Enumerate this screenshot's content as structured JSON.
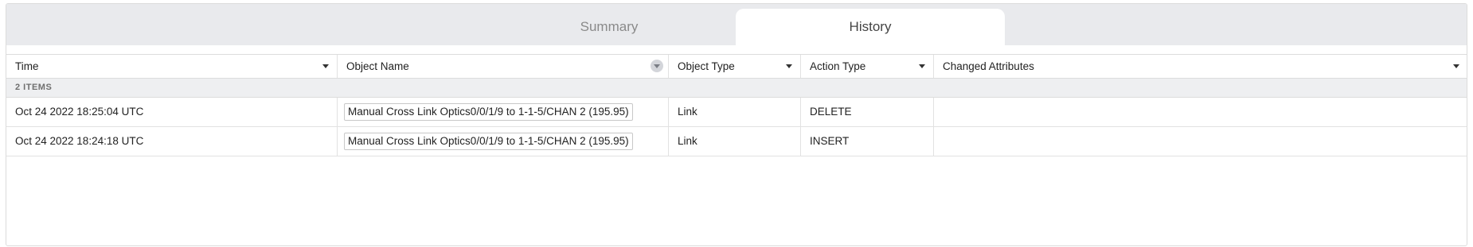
{
  "tabs": [
    {
      "label": "Summary",
      "active": false
    },
    {
      "label": "History",
      "active": true
    }
  ],
  "table": {
    "columns": [
      "Time",
      "Object Name",
      "Object Type",
      "Action Type",
      "Changed Attributes"
    ],
    "group_label": "2 ITEMS",
    "rows": [
      {
        "time": "Oct 24 2022 18:25:04 UTC",
        "object_name": "Manual Cross Link Optics0/0/1/9 to 1-1-5/CHAN 2 (195.95)",
        "object_type": "Link",
        "action_type": "DELETE",
        "changed_attributes": ""
      },
      {
        "time": "Oct 24 2022 18:24:18 UTC",
        "object_name": "Manual Cross Link Optics0/0/1/9 to 1-1-5/CHAN 2 (195.95)",
        "object_type": "Link",
        "action_type": "INSERT",
        "changed_attributes": ""
      }
    ]
  },
  "icons": {
    "column_menu": "caret-down-icon",
    "sort_indicator": "sort-circle-icon"
  },
  "colors": {
    "tabbar_bg": "#e9eaed",
    "group_bg": "#eeeff1"
  }
}
